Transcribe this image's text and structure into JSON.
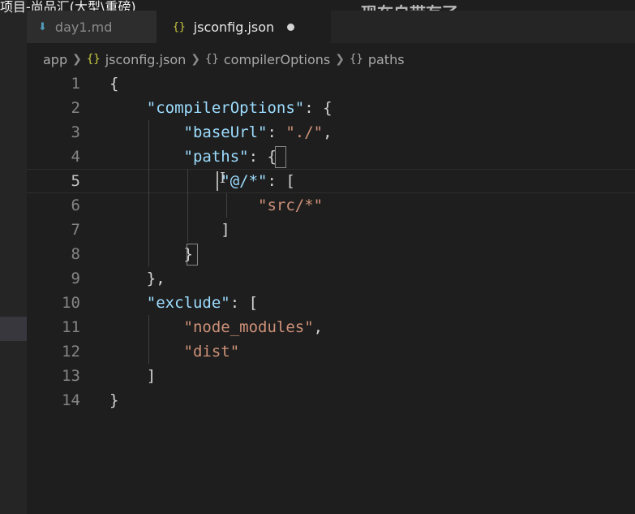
{
  "window": {
    "title_fragment": "项目-尚品汇(大型\\重磅)",
    "overlay_caption": "现在自带有了"
  },
  "tabs": [
    {
      "label": "day1.md",
      "icon": "markdown-icon",
      "active": false
    },
    {
      "label": "jsconfig.json",
      "icon": "json-braces-icon",
      "active": true,
      "dirty": true
    }
  ],
  "breadcrumb": {
    "items": [
      "app",
      "jsconfig.json",
      "compilerOptions",
      "paths"
    ],
    "icons": [
      "",
      "{}",
      "{}",
      "{}"
    ]
  },
  "editor": {
    "language": "json",
    "current_line": 5,
    "lines": [
      {
        "n": "1",
        "tokens": [
          {
            "t": "p",
            "v": "{"
          }
        ]
      },
      {
        "n": "2",
        "tokens": [
          {
            "t": "p",
            "v": "    "
          },
          {
            "t": "k",
            "v": "\"compilerOptions\""
          },
          {
            "t": "p",
            "v": ": {"
          }
        ]
      },
      {
        "n": "3",
        "tokens": [
          {
            "t": "p",
            "v": "        "
          },
          {
            "t": "k",
            "v": "\"baseUrl\""
          },
          {
            "t": "p",
            "v": ": "
          },
          {
            "t": "s",
            "v": "\"./\""
          },
          {
            "t": "p",
            "v": ","
          }
        ]
      },
      {
        "n": "4",
        "tokens": [
          {
            "t": "p",
            "v": "        "
          },
          {
            "t": "k",
            "v": "\"paths\""
          },
          {
            "t": "p",
            "v": ": {"
          }
        ]
      },
      {
        "n": "5",
        "tokens": [
          {
            "t": "p",
            "v": "            "
          },
          {
            "t": "k",
            "v": "\"@/*\""
          },
          {
            "t": "p",
            "v": ": ["
          }
        ]
      },
      {
        "n": "6",
        "tokens": [
          {
            "t": "p",
            "v": "                "
          },
          {
            "t": "s",
            "v": "\"src/*\""
          }
        ]
      },
      {
        "n": "7",
        "tokens": [
          {
            "t": "p",
            "v": "            ]"
          }
        ]
      },
      {
        "n": "8",
        "tokens": [
          {
            "t": "p",
            "v": "        }"
          }
        ]
      },
      {
        "n": "9",
        "tokens": [
          {
            "t": "p",
            "v": "    },"
          }
        ]
      },
      {
        "n": "10",
        "tokens": [
          {
            "t": "p",
            "v": "    "
          },
          {
            "t": "k",
            "v": "\"exclude\""
          },
          {
            "t": "p",
            "v": ": ["
          }
        ]
      },
      {
        "n": "11",
        "tokens": [
          {
            "t": "p",
            "v": "        "
          },
          {
            "t": "s",
            "v": "\"node_modules\""
          },
          {
            "t": "p",
            "v": ","
          }
        ]
      },
      {
        "n": "12",
        "tokens": [
          {
            "t": "p",
            "v": "        "
          },
          {
            "t": "s",
            "v": "\"dist\""
          }
        ]
      },
      {
        "n": "13",
        "tokens": [
          {
            "t": "p",
            "v": "    ]"
          }
        ]
      },
      {
        "n": "14",
        "tokens": [
          {
            "t": "p",
            "v": "}"
          }
        ]
      }
    ]
  },
  "colors": {
    "background": "#1e1e1e",
    "key": "#9cdcfe",
    "string": "#ce9178",
    "punctuation": "#d4d4d4",
    "json_icon": "#cbcb41",
    "md_icon": "#519aba"
  }
}
